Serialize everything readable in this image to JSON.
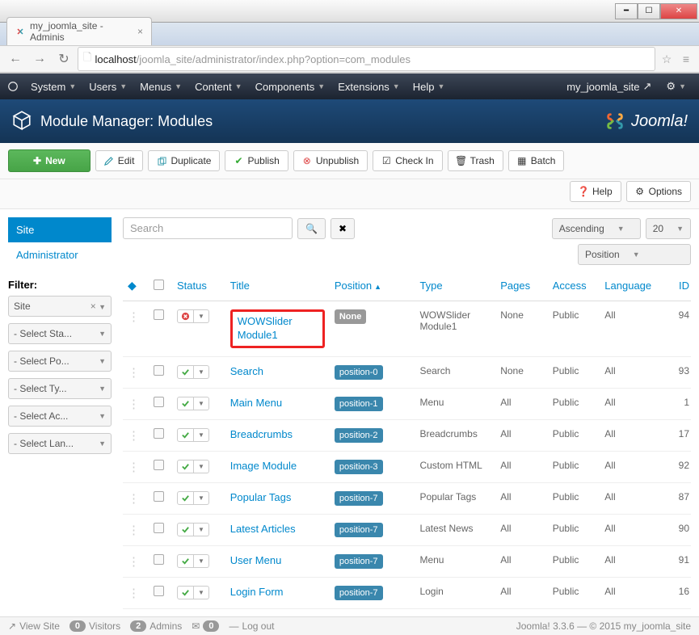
{
  "browser": {
    "tab_title": "my_joomla_site - Adminis",
    "url_host": "localhost",
    "url_path": "/joomla_site/administrator/index.php?option=com_modules"
  },
  "admin_menu": {
    "items": [
      "System",
      "Users",
      "Menus",
      "Content",
      "Components",
      "Extensions",
      "Help"
    ],
    "site_name": "my_joomla_site"
  },
  "page": {
    "title": "Module Manager: Modules",
    "brand": "Joomla!"
  },
  "toolbar": {
    "new": "New",
    "edit": "Edit",
    "duplicate": "Duplicate",
    "publish": "Publish",
    "unpublish": "Unpublish",
    "checkin": "Check In",
    "trash": "Trash",
    "batch": "Batch",
    "help": "Help",
    "options": "Options"
  },
  "sidebar": {
    "tabs": {
      "site": "Site",
      "admin": "Administrator"
    },
    "filter_label": "Filter:",
    "site_filter": "Site",
    "selects": [
      "- Select Sta...",
      "- Select Po...",
      "- Select Ty...",
      "- Select Ac...",
      "- Select Lan..."
    ]
  },
  "search": {
    "placeholder": "Search",
    "order": "Ascending",
    "limit": "20",
    "sort_by": "Position"
  },
  "columns": {
    "status": "Status",
    "title": "Title",
    "position": "Position",
    "type": "Type",
    "pages": "Pages",
    "access": "Access",
    "language": "Language",
    "id": "ID"
  },
  "position_none": "None",
  "rows": [
    {
      "published": false,
      "title": "WOWSlider Module1",
      "position": null,
      "type": "WOWSlider Module1",
      "pages": "None",
      "access": "Public",
      "language": "All",
      "id": "94",
      "highlight": true
    },
    {
      "published": true,
      "title": "Search",
      "position": "position-0",
      "type": "Search",
      "pages": "None",
      "access": "Public",
      "language": "All",
      "id": "93"
    },
    {
      "published": true,
      "title": "Main Menu",
      "position": "position-1",
      "type": "Menu",
      "pages": "All",
      "access": "Public",
      "language": "All",
      "id": "1"
    },
    {
      "published": true,
      "title": "Breadcrumbs",
      "position": "position-2",
      "type": "Breadcrumbs",
      "pages": "All",
      "access": "Public",
      "language": "All",
      "id": "17"
    },
    {
      "published": true,
      "title": "Image Module",
      "position": "position-3",
      "type": "Custom HTML",
      "pages": "All",
      "access": "Public",
      "language": "All",
      "id": "92"
    },
    {
      "published": true,
      "title": "Popular Tags",
      "position": "position-7",
      "type": "Popular Tags",
      "pages": "All",
      "access": "Public",
      "language": "All",
      "id": "87"
    },
    {
      "published": true,
      "title": "Latest Articles",
      "position": "position-7",
      "type": "Latest News",
      "pages": "All",
      "access": "Public",
      "language": "All",
      "id": "90"
    },
    {
      "published": true,
      "title": "User Menu",
      "position": "position-7",
      "type": "Menu",
      "pages": "All",
      "access": "Public",
      "language": "All",
      "id": "91"
    },
    {
      "published": true,
      "title": "Login Form",
      "position": "position-7",
      "type": "Login",
      "pages": "All",
      "access": "Public",
      "language": "All",
      "id": "16"
    }
  ],
  "footer": {
    "view_site": "View Site",
    "visitors_count": "0",
    "visitors": "Visitors",
    "admins_count": "2",
    "admins": "Admins",
    "msgs_count": "0",
    "logout": "Log out",
    "copyright": "Joomla! 3.3.6  —  © 2015 my_joomla_site"
  }
}
